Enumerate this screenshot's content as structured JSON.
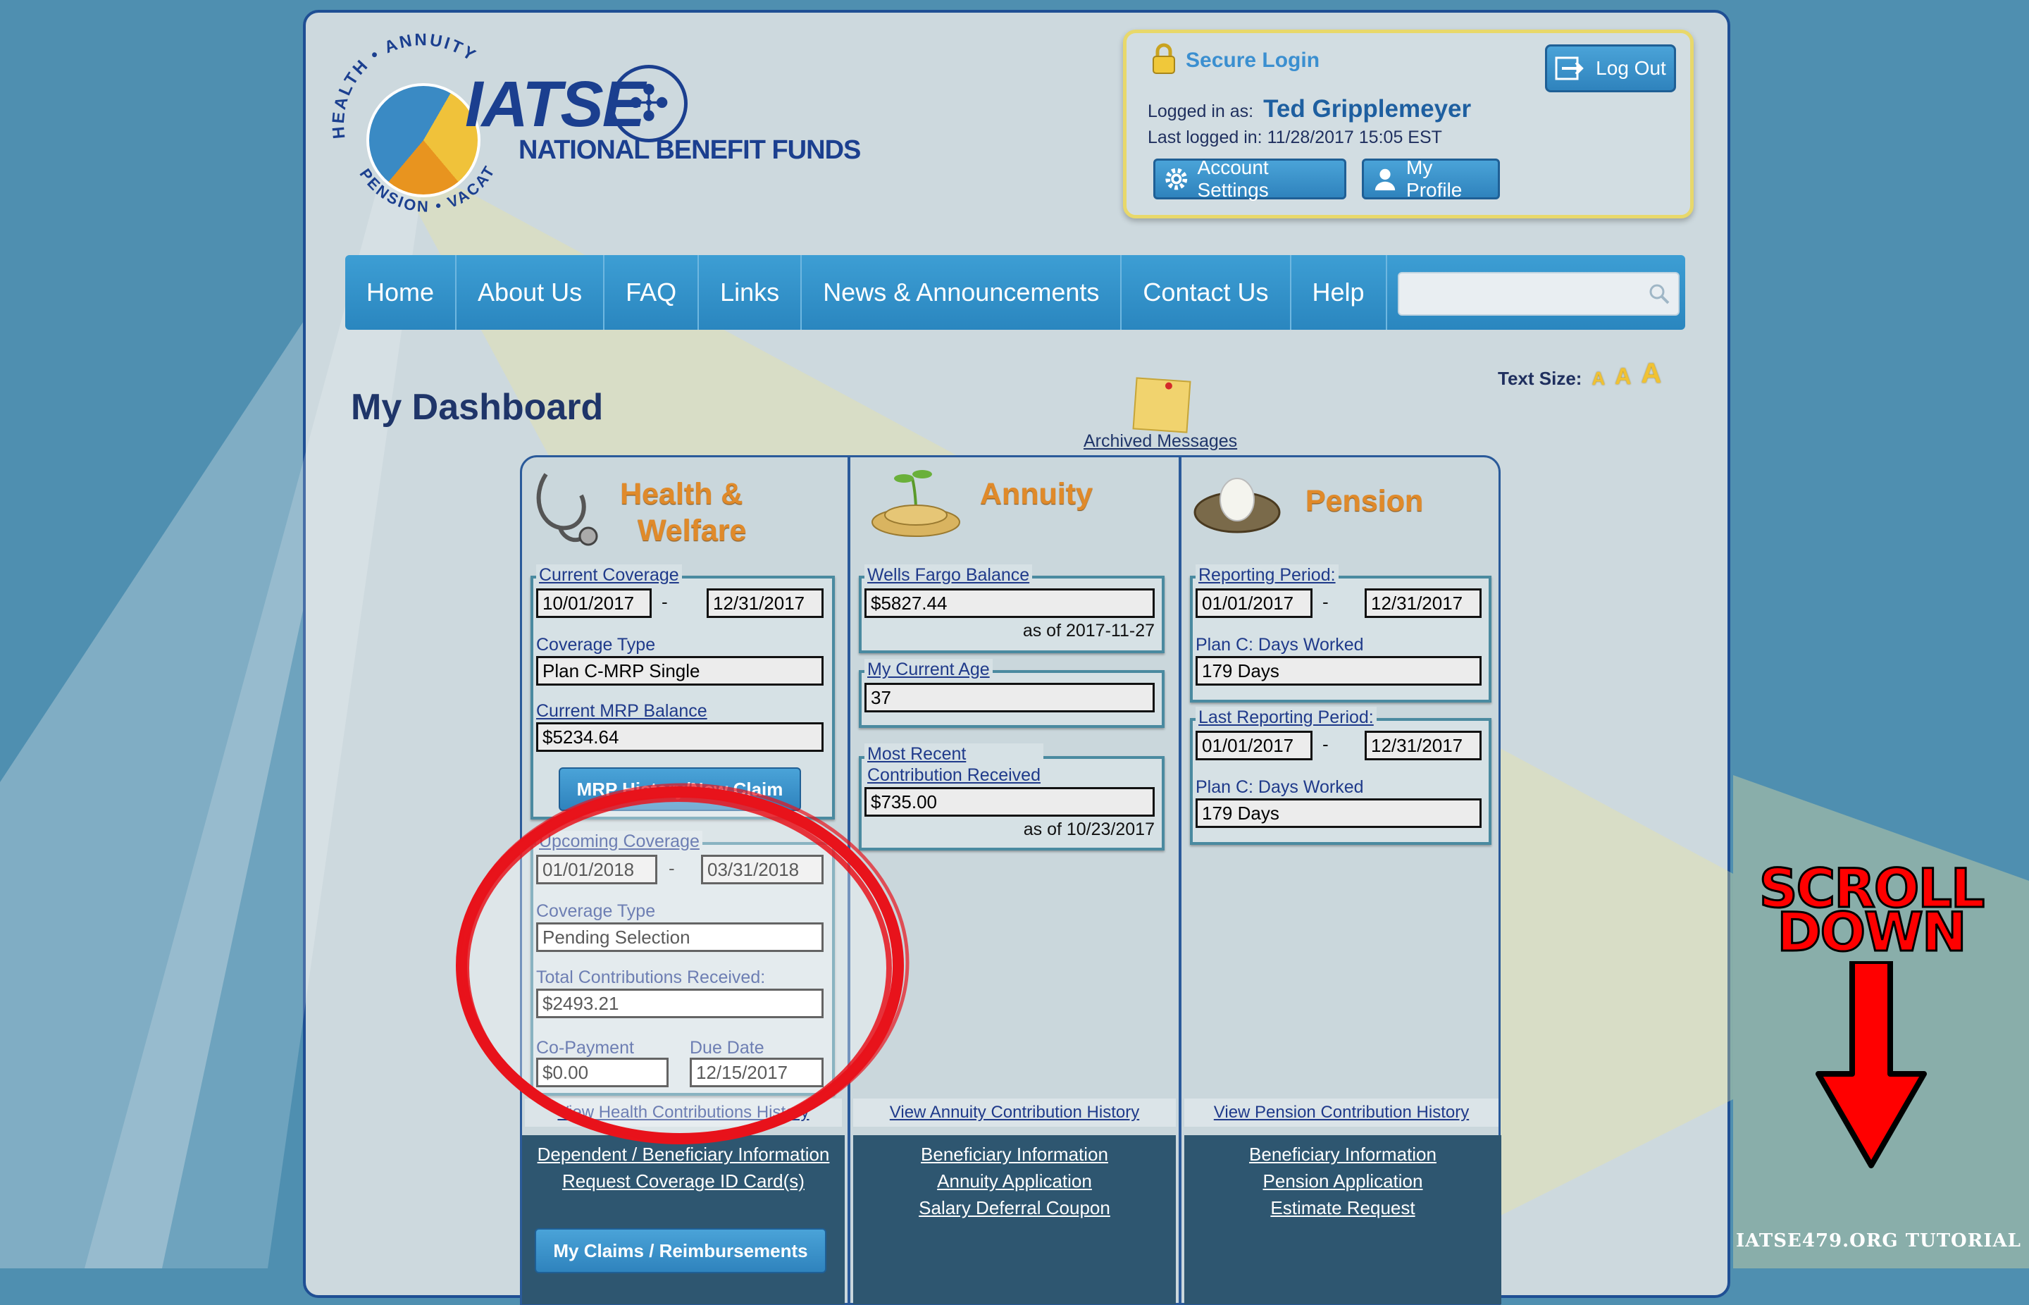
{
  "logo": {
    "ring_top": "HEALTH • ANNUITY",
    "ring_bottom": "PENSION • VACATION",
    "name": "IATSE",
    "subtitle": "NATIONAL BENEFIT FUNDS"
  },
  "login": {
    "title": "Secure Login",
    "logout_label": "Log Out",
    "logged_in_label": "Logged in as:",
    "user_name": "Ted Gripplemeyer",
    "last_logged_label": "Last logged in: 11/28/2017 15:05 EST",
    "account_settings_label": "Account Settings",
    "my_profile_label": "My Profile"
  },
  "nav": {
    "items": [
      "Home",
      "About Us",
      "FAQ",
      "Links",
      "News & Announcements",
      "Contact Us",
      "Help"
    ],
    "search_placeholder": ""
  },
  "text_size": {
    "label": "Text Size:",
    "options": [
      "A",
      "A",
      "A"
    ]
  },
  "dashboard": {
    "title": "My Dashboard",
    "archived_messages": "Archived Messages"
  },
  "health": {
    "title_line1": "Health &",
    "title_line2": "Welfare",
    "current_coverage_label": "Current Coverage",
    "current_from": "10/01/2017",
    "current_to": "12/31/2017",
    "coverage_type_label": "Coverage Type",
    "coverage_type": "Plan C-MRP Single",
    "mrp_balance_label": "Current MRP Balance",
    "mrp_balance": "$5234.64",
    "mrp_button": "MRP History/New Claim",
    "upcoming_label": "Upcoming Coverage",
    "upcoming_from": "01/01/2018",
    "upcoming_to": "03/31/2018",
    "upcoming_type_label": "Coverage Type",
    "upcoming_type": "Pending Selection",
    "total_contrib_label": "Total Contributions Received:",
    "total_contrib": "$2493.21",
    "copay_label": "Co-Payment",
    "copay": "$0.00",
    "due_label": "Due Date",
    "due": "12/15/2017",
    "history_link": "View Health Contributions History",
    "bottom_links": [
      "Dependent / Beneficiary Information",
      "Request Coverage ID Card(s)"
    ],
    "claims_button": "My Claims / Reimbursements"
  },
  "annuity": {
    "title": "Annuity",
    "wells_label": "Wells Fargo Balance",
    "wells_balance": "$5827.44",
    "wells_asof": "as of 2017-11-27",
    "age_label": "My Current Age",
    "age": "37",
    "recent_label_1": "Most Recent",
    "recent_label_2": "Contribution Received",
    "recent_value": "$735.00",
    "recent_asof": "as of 10/23/2017",
    "history_link": "View Annuity Contribution History",
    "bottom_links": [
      "Beneficiary Information",
      "Annuity Application",
      "Salary Deferral Coupon"
    ]
  },
  "pension": {
    "title": "Pension",
    "reporting_label": "Reporting Period:",
    "reporting_from": "01/01/2017",
    "reporting_to": "12/31/2017",
    "days_label": "Plan C: Days Worked",
    "days": "179 Days",
    "last_label": "Last Reporting Period:",
    "last_from": "01/01/2017",
    "last_to": "12/31/2017",
    "last_days_label": "Plan C: Days Worked",
    "last_days": "179 Days",
    "history_link": "View Pension Contribution History",
    "bottom_links": [
      "Beneficiary Information",
      "Pension Application",
      "Estimate Request"
    ]
  },
  "callout": {
    "line1": "SCROLL",
    "line2": "DOWN"
  },
  "watermark": "IATSE479.ORG TUTORIAL",
  "colors": {
    "nav_blue": "#2a86bf",
    "title_orange": "#e08a2a",
    "highlight_red": "#e8131b",
    "border_navy": "#1f4f94"
  },
  "icons": [
    "lock-icon",
    "logout-icon",
    "gear-icon",
    "user-icon",
    "search-icon",
    "stethoscope-icon",
    "coins-sprout-icon",
    "nest-egg-icon",
    "sticky-note-icon",
    "down-arrow-icon"
  ]
}
